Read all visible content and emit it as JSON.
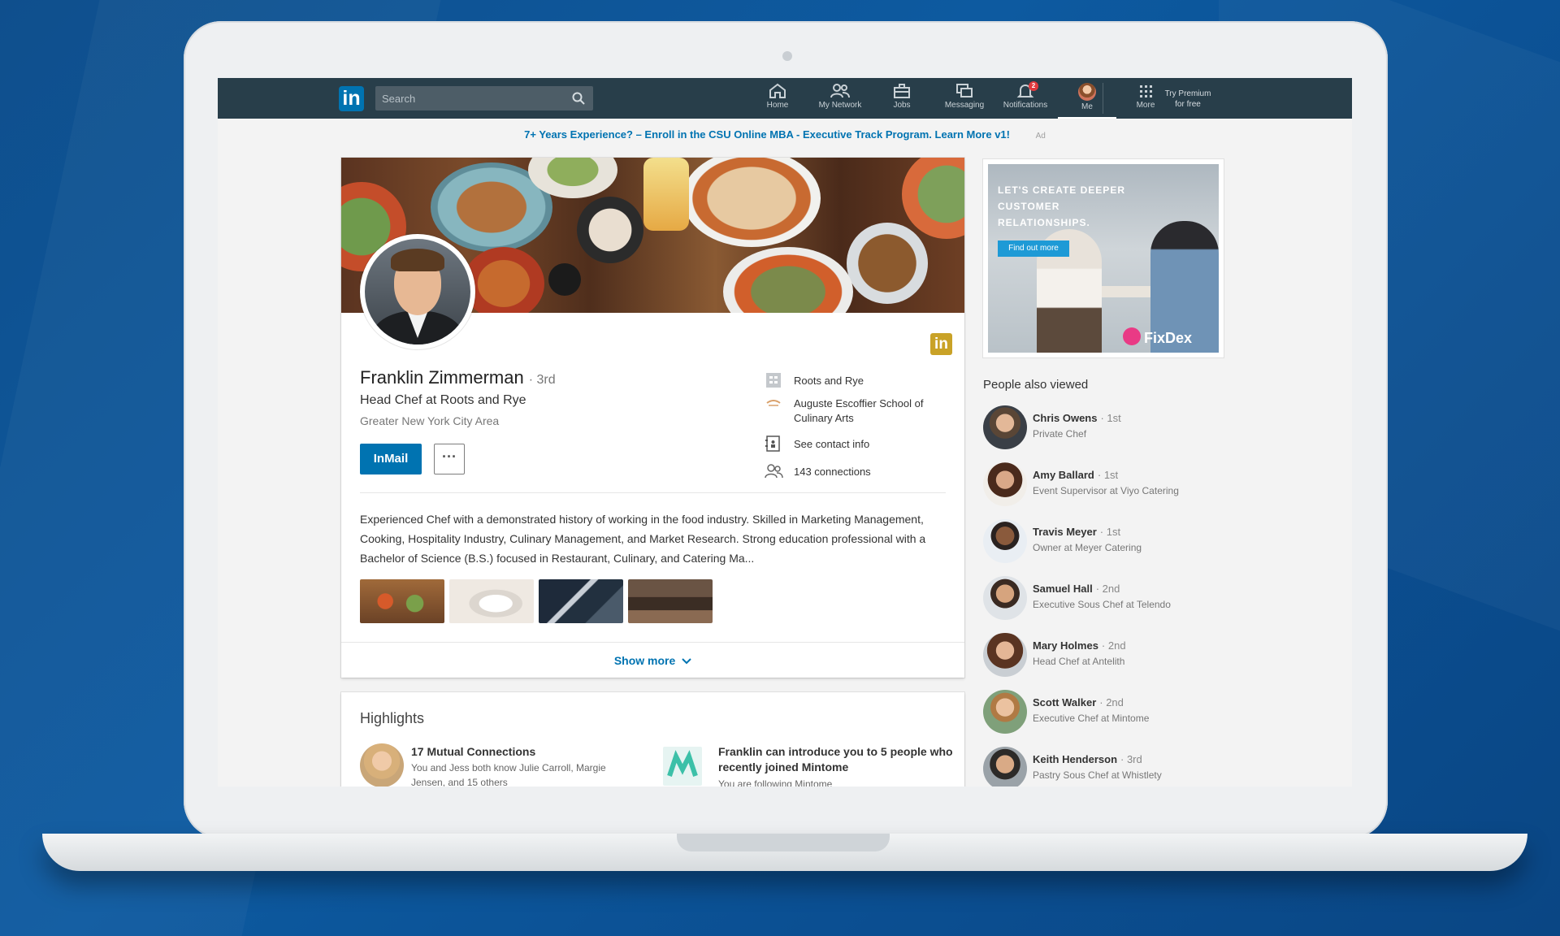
{
  "nav": {
    "logo": "in",
    "search_placeholder": "Search",
    "items": [
      {
        "label": "Home",
        "icon": "home-icon"
      },
      {
        "label": "My Network",
        "icon": "network-icon"
      },
      {
        "label": "Jobs",
        "icon": "briefcase-icon"
      },
      {
        "label": "Messaging",
        "icon": "messaging-icon"
      },
      {
        "label": "Notifications",
        "icon": "bell-icon",
        "badge": "2"
      },
      {
        "label": "Me",
        "icon": "avatar"
      },
      {
        "label": "More",
        "icon": "grid-icon"
      }
    ],
    "premium_line1": "Try Premium",
    "premium_line2": "for free"
  },
  "ad_strip": {
    "text": "7+ Years Experience? – Enroll in the CSU Online MBA - Executive Track Program. Learn More v1!",
    "tag": "Ad"
  },
  "profile": {
    "name": "Franklin Zimmerman",
    "degree": "· 3rd",
    "headline": "Head Chef at Roots and Rye",
    "location": "Greater New York City Area",
    "inmail_label": "InMail",
    "more_label": "···",
    "badge": "in",
    "side": {
      "company": "Roots and Rye",
      "school": "Auguste Escoffier School of Culinary Arts",
      "contact": "See contact info",
      "connections": "143 connections"
    },
    "summary": "Experienced Chef with a demonstrated history of working in the food industry. Skilled in Marketing Management, Cooking, Hospitality Industry, Culinary Management, and Market Research. Strong education professional with a Bachelor of Science (B.S.) focused in Restaurant, Culinary, and Catering Ma...",
    "show_more": "Show more"
  },
  "highlights": {
    "title": "Highlights",
    "mutual_title": "17 Mutual Connections",
    "mutual_sub": "You and Jess both know Julie Carroll, Margie Jensen, and 15 others",
    "intro_title": "Franklin can introduce you to 5 people who recently joined Mintome",
    "intro_sub": "You are following Mintome"
  },
  "right_ad": {
    "headline": "LET'S CREATE DEEPER CUSTOMER RELATIONSHIPS.",
    "button": "Find out more",
    "brand": "FixDex"
  },
  "people_also_viewed": {
    "title": "People also viewed",
    "people": [
      {
        "name": "Chris Owens",
        "degree": "· 1st",
        "title": "Private Chef"
      },
      {
        "name": "Amy Ballard",
        "degree": "· 1st",
        "title": "Event Supervisor at Viyo Catering"
      },
      {
        "name": "Travis Meyer",
        "degree": "· 1st",
        "title": "Owner at Meyer Catering"
      },
      {
        "name": "Samuel Hall",
        "degree": "· 2nd",
        "title": "Executive Sous Chef at Telendo"
      },
      {
        "name": "Mary Holmes",
        "degree": "· 2nd",
        "title": "Head Chef at Antelith"
      },
      {
        "name": "Scott Walker",
        "degree": "· 2nd",
        "title": "Executive Chef at Mintome"
      },
      {
        "name": "Keith Henderson",
        "degree": "· 3rd",
        "title": "Pastry Sous Chef at Whistlety"
      }
    ]
  }
}
